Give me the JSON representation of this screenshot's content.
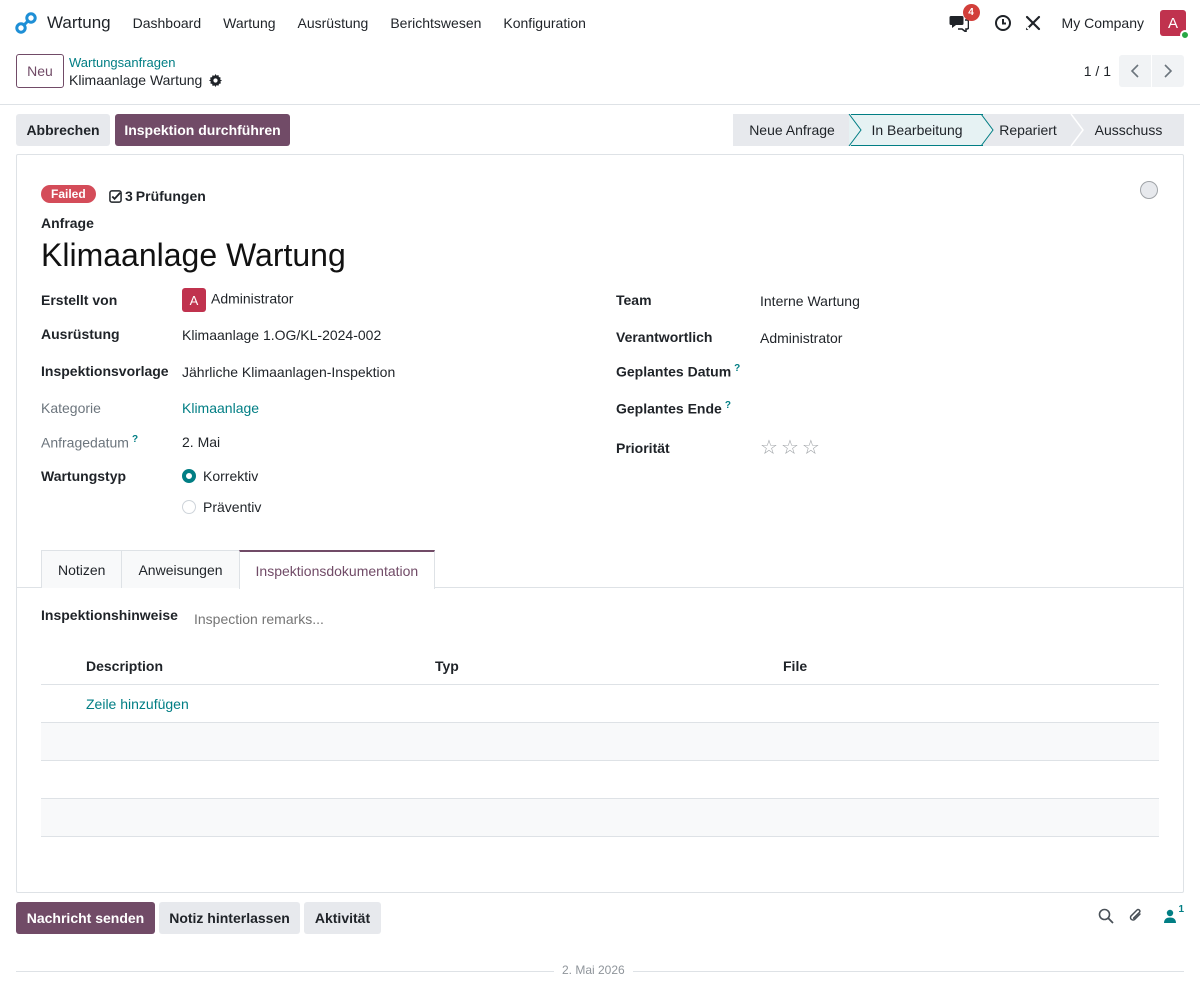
{
  "navbar": {
    "app_name": "Wartung",
    "menu": [
      "Dashboard",
      "Wartung",
      "Ausrüstung",
      "Berichtswesen",
      "Konfiguration"
    ],
    "messages_count": "4",
    "company": "My Company",
    "avatar_letter": "A"
  },
  "control": {
    "new_label": "Neu",
    "breadcrumb_parent": "Wartungsanfragen",
    "breadcrumb_current": "Klimaanlage Wartung",
    "pager": "1 / 1"
  },
  "actions": {
    "cancel": "Abbrechen",
    "inspect": "Inspektion durchführen"
  },
  "stages": [
    "Neue Anfrage",
    "In Bearbeitung",
    "Repariert",
    "Ausschuss"
  ],
  "active_stage": "In Bearbeitung",
  "record": {
    "status_badge": "Failed",
    "checks_count": "3",
    "checks_label": "Prüfungen",
    "request_label": "Anfrage",
    "title": "Klimaanlage Wartung"
  },
  "fields_left": {
    "created_by_label": "Erstellt von",
    "created_by_avatar": "A",
    "created_by": "Administrator",
    "equipment_label": "Ausrüstung",
    "equipment": "Klimaanlage 1.OG/KL-2024-002",
    "template_label": "Inspektionsvorlage",
    "template": "Jährliche Klimaanlagen-Inspektion",
    "category_label": "Kategorie",
    "category": "Klimaanlage",
    "request_date_label": "Anfragedatum",
    "request_date": "2. Mai",
    "type_label": "Wartungstyp",
    "type_options": [
      "Korrektiv",
      "Präventiv"
    ],
    "type_selected": "Korrektiv"
  },
  "fields_right": {
    "team_label": "Team",
    "team": "Interne Wartung",
    "responsible_label": "Verantwortlich",
    "responsible": "Administrator",
    "planned_date_label": "Geplantes Datum",
    "planned_end_label": "Geplantes Ende",
    "priority_label": "Priorität",
    "priority_stars": 0,
    "priority_max": 3
  },
  "tabs": [
    "Notizen",
    "Anweisungen",
    "Inspektionsdokumentation"
  ],
  "active_tab": "Inspektionsdokumentation",
  "inspection": {
    "remarks_label": "Inspektionshinweise",
    "remarks_placeholder": "Inspection remarks...",
    "columns": [
      "Description",
      "Typ",
      "File"
    ],
    "add_line": "Zeile hinzufügen"
  },
  "chatter": {
    "send": "Nachricht senden",
    "note": "Notiz hinterlassen",
    "activity": "Aktivität",
    "followers": "1",
    "date_separator": "2. Mai 2026"
  },
  "colors": {
    "primary": "#714b67",
    "teal": "#017e84",
    "danger": "#d44c59"
  }
}
